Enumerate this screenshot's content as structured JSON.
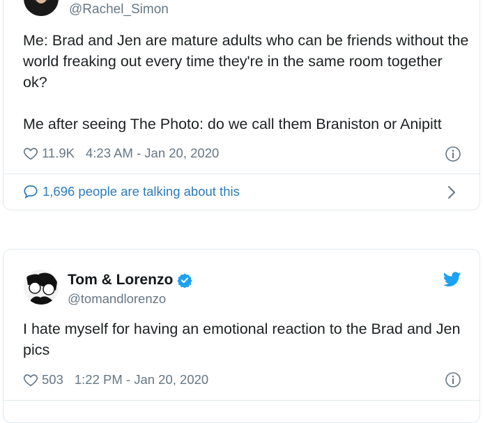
{
  "tweet1": {
    "handle": "@Rachel_Simon",
    "text": "Me: Brad and Jen are mature adults who can be friends without the world freaking out every time they're in the same room together ok?\n\nMe after seeing The Photo: do we call them Braniston or Anipitt",
    "likes": "11.9K",
    "timestamp": "4:23 AM - Jan 20, 2020",
    "talking": "1,696 people are talking about this"
  },
  "tweet2": {
    "author": "Tom & Lorenzo",
    "handle": "@tomandlorenzo",
    "text": "I hate myself for having an emotional reaction to the Brad and Jen pics",
    "likes": "503",
    "timestamp": "1:22 PM - Jan 20, 2020"
  },
  "colors": {
    "link": "#2b7bb9",
    "muted": "#657786",
    "verified": "#1da1f2",
    "border": "#e1e8ed"
  },
  "icons": [
    "heart-icon",
    "info-icon",
    "speech-bubble-icon",
    "chevron-right-icon",
    "verified-badge-icon",
    "twitter-bird-icon"
  ]
}
